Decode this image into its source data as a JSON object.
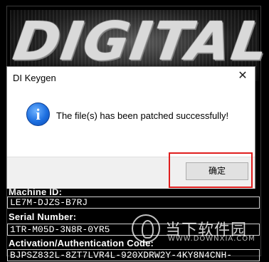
{
  "keygen": {
    "logo_text": "DIGITAL",
    "fields": [
      {
        "label": "Machine ID:",
        "value": "LE7M-DJZS-B7RJ"
      },
      {
        "label": "Serial Number:",
        "value": "1TR-M05D-3N8R-0YR5"
      },
      {
        "label": "Activation/Authentication Code:",
        "value": "BJPSZ832L-8ZT7LVR4L-920XDRW2Y-4KY8N4CNH-"
      }
    ]
  },
  "dialog": {
    "title": "DI Keygen",
    "close_glyph": "✕",
    "icon": "info-icon",
    "message": "The file(s) has been patched successfully!",
    "ok_label": "确定",
    "highlight_color": "#e01e1e"
  },
  "watermark": {
    "cn": "当下软件园",
    "en": "WWW.DOWNXIA.COM"
  }
}
